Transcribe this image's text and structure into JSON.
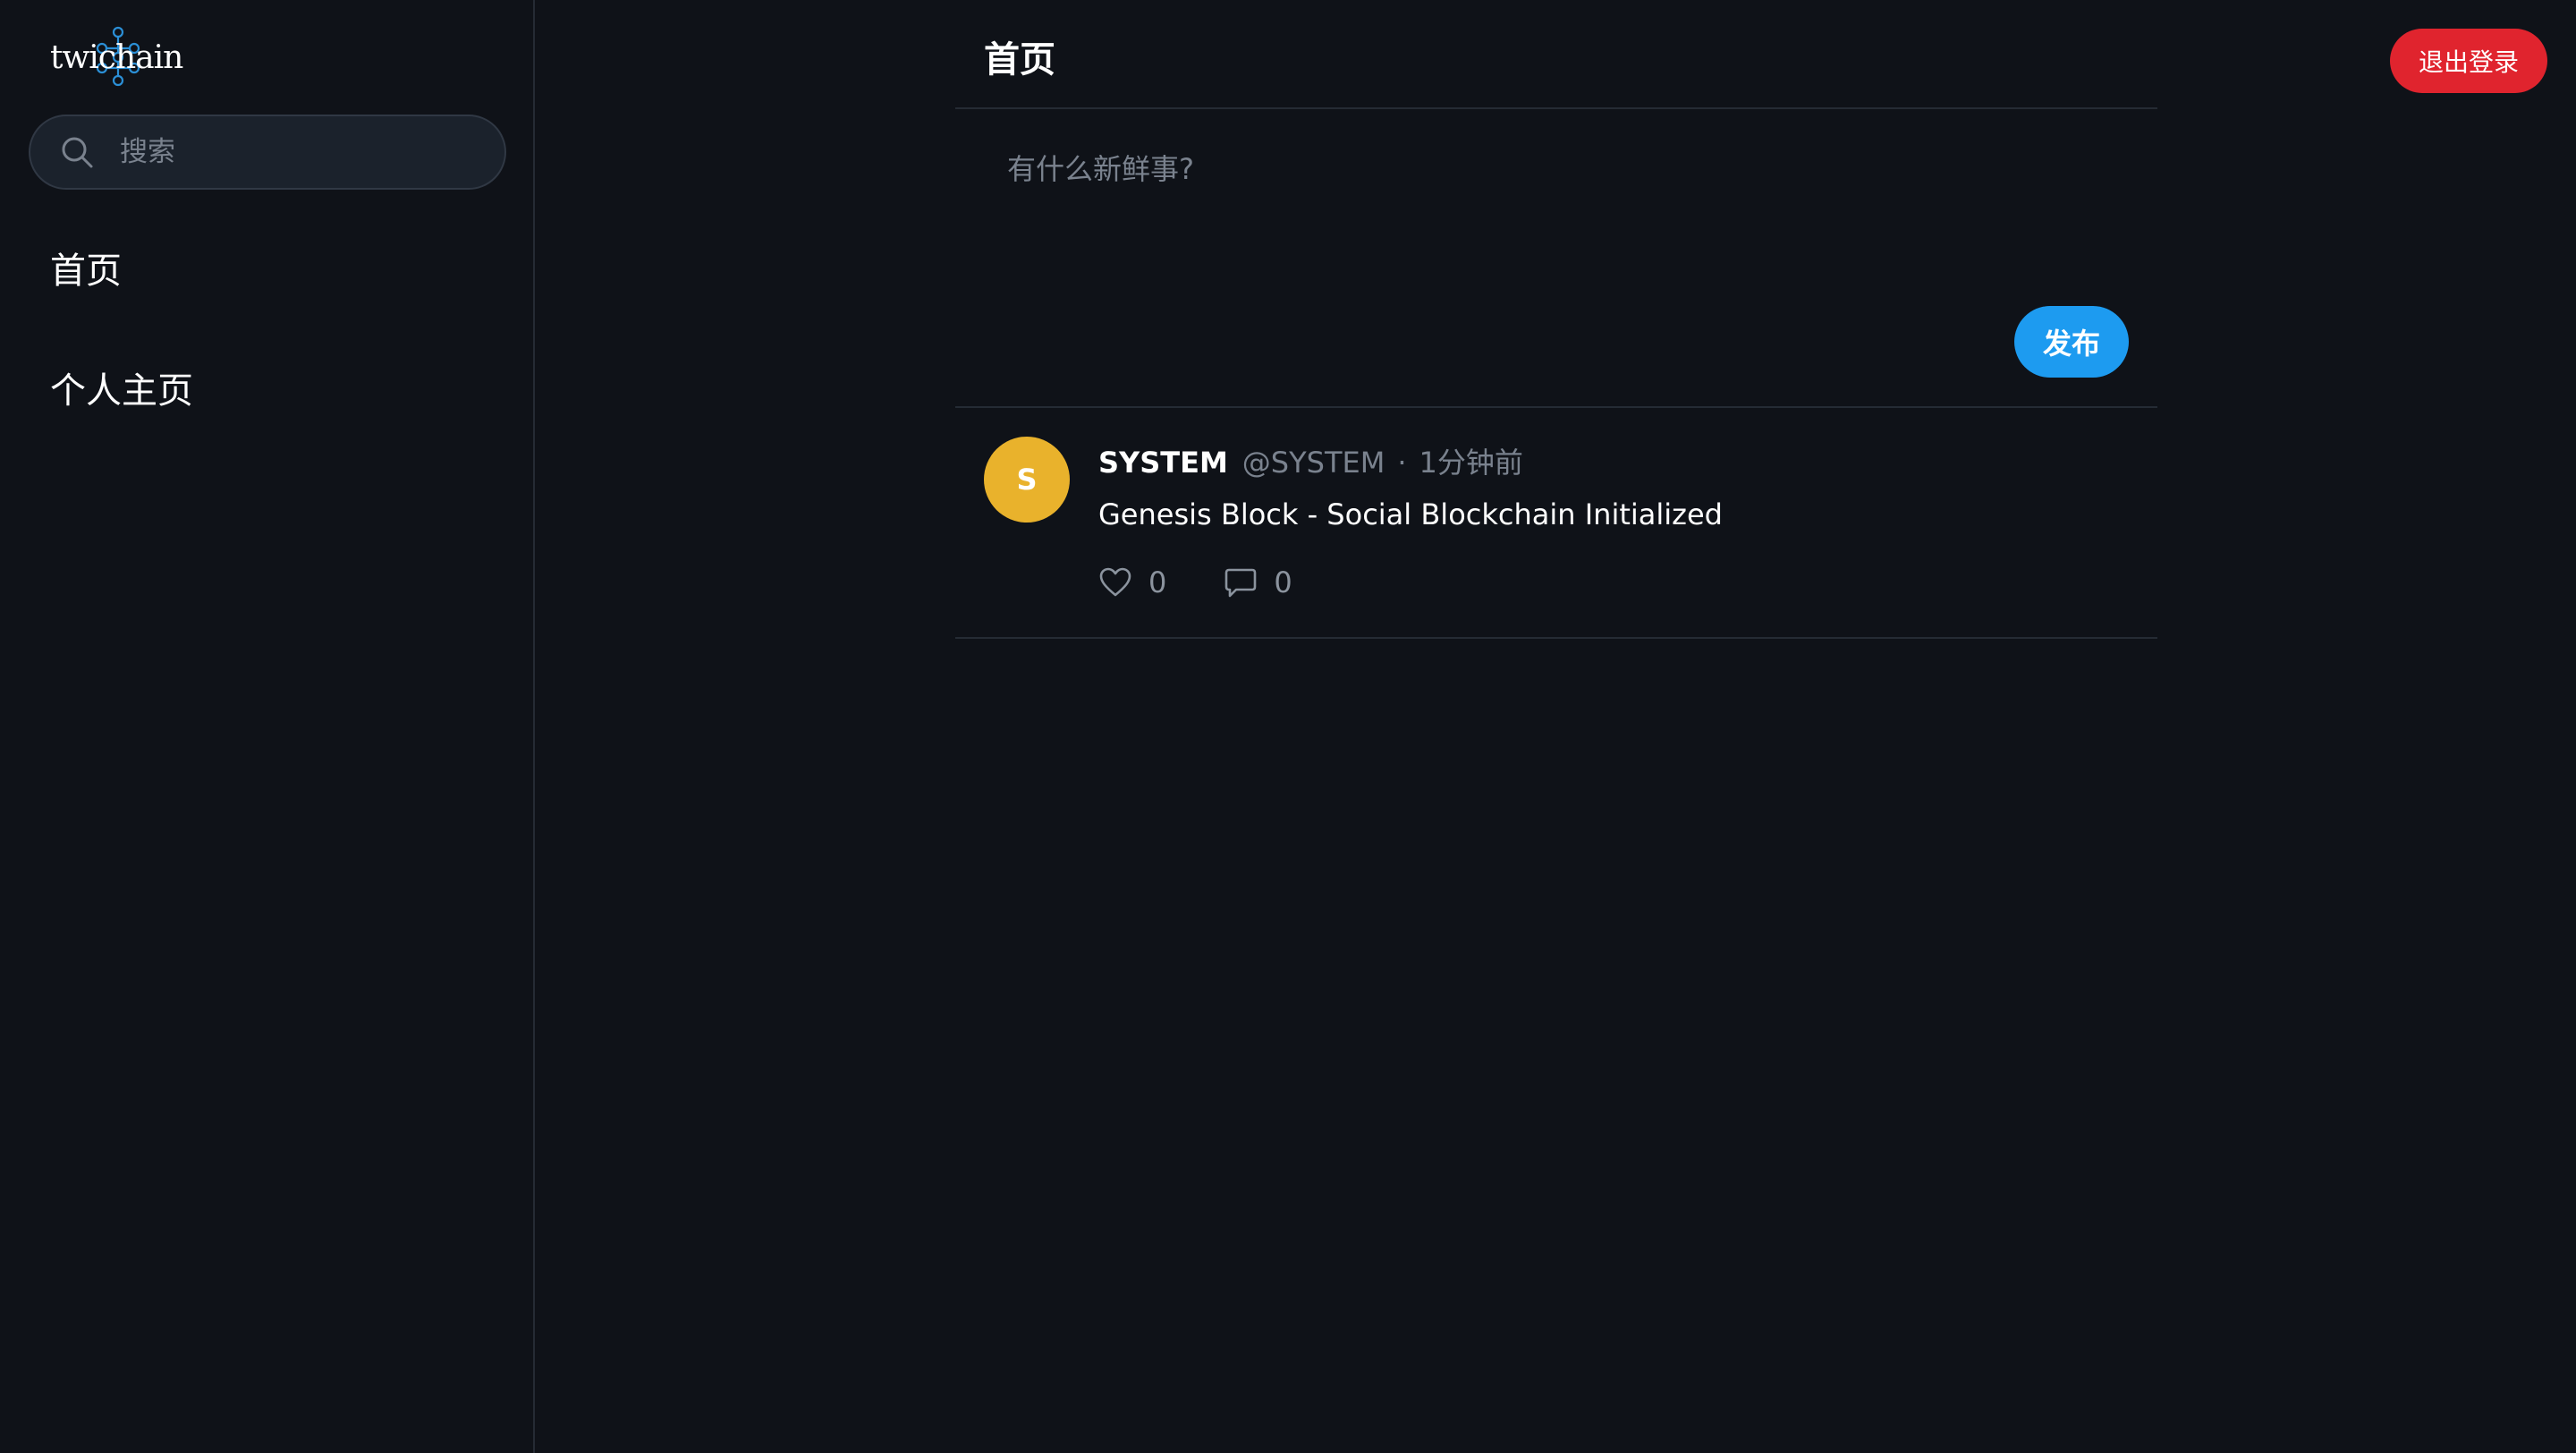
{
  "app": {
    "logo_text": "twichain"
  },
  "sidebar": {
    "search": {
      "placeholder": "搜索",
      "value": ""
    },
    "items": [
      {
        "label": "首页"
      },
      {
        "label": "个人主页"
      }
    ]
  },
  "header": {
    "title": "首页",
    "logout_label": "退出登录"
  },
  "composer": {
    "placeholder": "有什么新鲜事?",
    "value": "",
    "publish_label": "发布"
  },
  "posts": [
    {
      "avatar_letter": "S",
      "name": "SYSTEM",
      "handle": "@SYSTEM",
      "separator": "·",
      "time": "1分钟前",
      "content": "Genesis Block - Social Blockchain Initialized",
      "likes": "0",
      "comments": "0"
    }
  ],
  "colors": {
    "background": "#0f1218",
    "accent": "#1d9bf0",
    "danger": "#e0242e",
    "avatar": "#e9b22c",
    "muted_text": "#7a828e"
  },
  "icons": {
    "search": "search-icon",
    "like": "heart-icon",
    "comment": "comment-icon",
    "logo": "chain-network-icon"
  }
}
